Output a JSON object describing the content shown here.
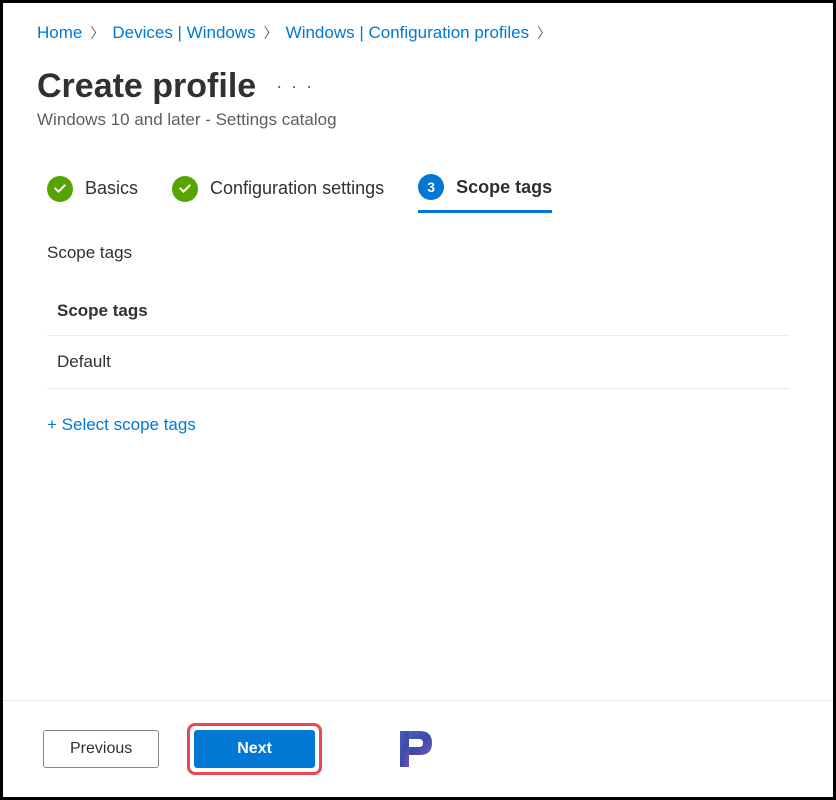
{
  "breadcrumb": {
    "items": [
      {
        "label": "Home"
      },
      {
        "label": "Devices | Windows"
      },
      {
        "label": "Windows | Configuration profiles"
      }
    ]
  },
  "header": {
    "title": "Create profile",
    "subtitle": "Windows 10 and later - Settings catalog"
  },
  "steps": [
    {
      "label": "Basics",
      "state": "done"
    },
    {
      "label": "Configuration settings",
      "state": "done"
    },
    {
      "label": "Scope tags",
      "state": "current",
      "number": "3"
    }
  ],
  "section": {
    "label": "Scope tags",
    "table_header": "Scope tags",
    "rows": [
      {
        "value": "Default"
      }
    ],
    "select_link": "+ Select scope tags"
  },
  "footer": {
    "previous_label": "Previous",
    "next_label": "Next"
  }
}
